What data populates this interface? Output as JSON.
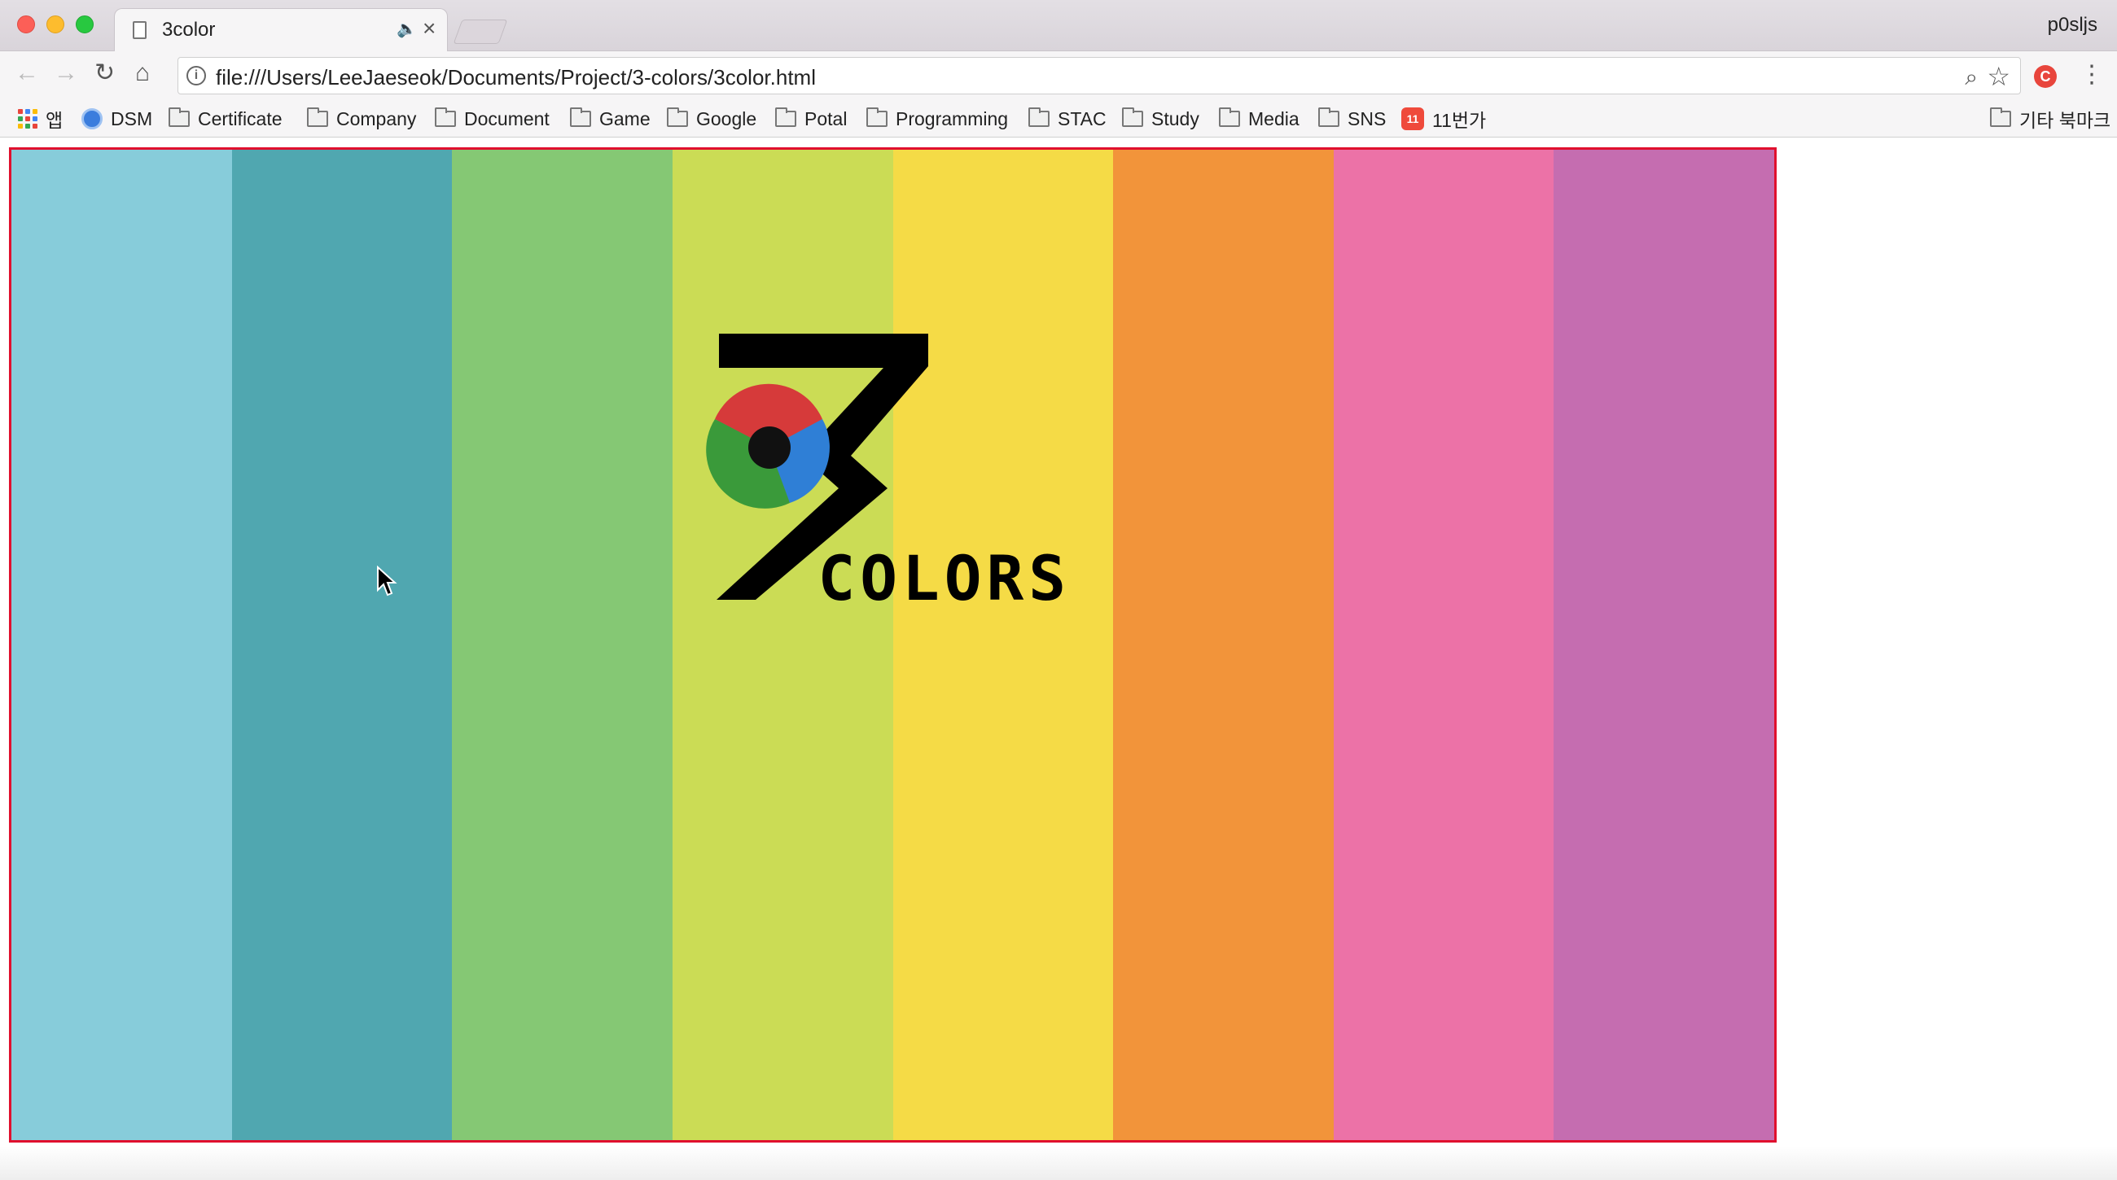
{
  "browser": {
    "tab": {
      "title": "3color"
    },
    "profile_name": "p0sljs",
    "address_bar": {
      "url": "file:///Users/LeeJaeseok/Documents/Project/3-colors/3color.html"
    },
    "bookmarks": {
      "apps_label": "앱",
      "items": [
        "DSM",
        "Certificate",
        "Company",
        "Document",
        "Game",
        "Google",
        "Potal",
        "Programming",
        "STAC",
        "Study",
        "Media",
        "SNS",
        "11번가"
      ],
      "other_bookmarks": "기타 북마크"
    }
  },
  "page": {
    "stripe_colors": [
      "#87ccda",
      "#50a7b0",
      "#85c874",
      "#cbdc55",
      "#f5db46",
      "#f2943a",
      "#ec72a7",
      "#c56db0"
    ],
    "border_color": "#e0102e",
    "logo": {
      "text": "COLORS",
      "eye_colors": [
        "#d63a3a",
        "#2f7fd6",
        "#3a9a3a"
      ]
    }
  }
}
